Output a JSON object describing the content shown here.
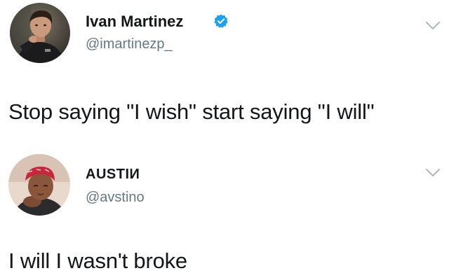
{
  "tweets": [
    {
      "display_name": "Ivan Martinez",
      "handle": "@imartinezp_",
      "verified": true,
      "text": "Stop saying \"I wish\" start saying \"I will\""
    },
    {
      "display_name": "AUSTIИ",
      "handle": "@avstino",
      "verified": false,
      "text": "I will I wasn't broke"
    }
  ],
  "colors": {
    "text": "#14171a",
    "secondary_text": "#657786",
    "verified_blue": "#1da1f2",
    "chevron": "#aab8c2",
    "divider": "#e6ecf0"
  },
  "icons": {
    "verified": "verified-badge-icon",
    "menu": "chevron-down-icon"
  }
}
